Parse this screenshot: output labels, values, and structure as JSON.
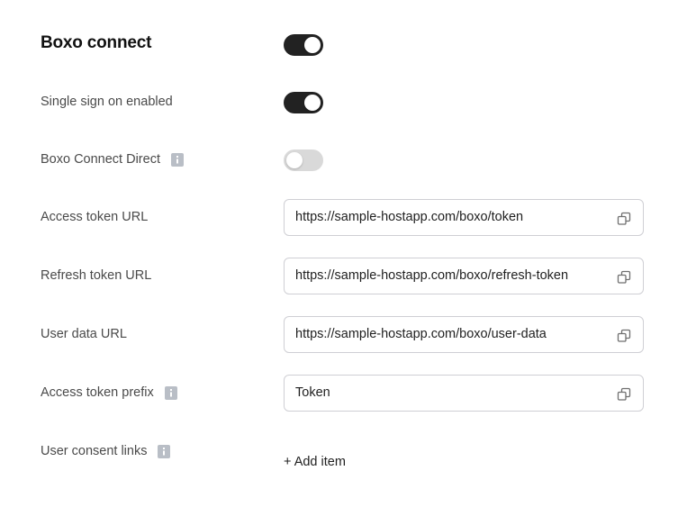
{
  "section": {
    "title": "Boxo connect",
    "enabled": true
  },
  "settings": {
    "sso": {
      "label": "Single sign on enabled",
      "enabled": true
    },
    "direct": {
      "label": "Boxo Connect Direct",
      "enabled": false,
      "icon": "info-icon"
    },
    "access_token_url": {
      "label": "Access token URL",
      "value": "https://sample-hostapp.com/boxo/token",
      "icon": "copy-icon"
    },
    "refresh_token_url": {
      "label": "Refresh token URL",
      "value": "https://sample-hostapp.com/boxo/refresh-token",
      "icon": "copy-icon"
    },
    "user_data_url": {
      "label": "User data URL",
      "value": "https://sample-hostapp.com/boxo/user-data",
      "icon": "copy-icon"
    },
    "access_token_prefix": {
      "label": "Access token prefix",
      "value": "Token",
      "icon": "copy-icon"
    },
    "user_consent_links": {
      "label": "User consent links",
      "add_label": "+ Add item"
    }
  },
  "colors": {
    "toggle_on": "#222222",
    "toggle_off": "#d9d9d9",
    "border": "#cfcfd4"
  }
}
